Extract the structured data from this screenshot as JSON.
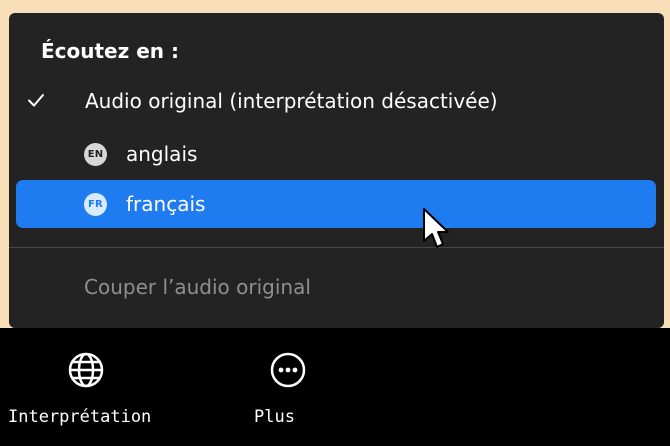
{
  "menu": {
    "header": "Écoutez en :",
    "items": [
      {
        "label": "Audio original (interprétation désactivée)",
        "checked": true
      },
      {
        "badge": "EN",
        "label": "anglais"
      },
      {
        "badge": "FR",
        "label": "français",
        "highlighted": true
      }
    ],
    "mute_original": "Couper l’audio original"
  },
  "toolbar": {
    "interpretation_label": "Interprétation",
    "more_label": "Plus"
  },
  "icons": {
    "check": "check-icon",
    "interpretation": "globe-icon",
    "more": "more-icon",
    "cursor": "cursor-pointer-icon"
  },
  "colors": {
    "background": "#f8dfb7",
    "menu": "#232323",
    "highlight": "#1f7cf0",
    "toolbar": "#000000",
    "disabled_text": "#8f8f8f"
  }
}
